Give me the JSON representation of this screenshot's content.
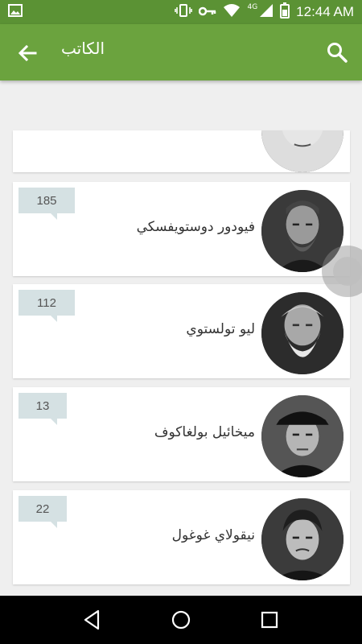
{
  "status_bar": {
    "time": "12:44 AM",
    "network": "4G",
    "icons": [
      "image-icon",
      "vibrate-icon",
      "key-icon",
      "wifi-icon",
      "signal-icon",
      "battery-icon"
    ]
  },
  "app_bar": {
    "title": "الكاتب",
    "back_icon": "arrow-back-icon",
    "search_icon": "search-icon",
    "color": "#6ba33e"
  },
  "authors": [
    {
      "name": "",
      "count": ""
    },
    {
      "name": "فيودور دوستويفسكي",
      "count": "185"
    },
    {
      "name": "ليو تولستوي",
      "count": "112"
    },
    {
      "name": "ميخائيل بولغاكوف",
      "count": "13"
    },
    {
      "name": "نيقولاي غوغول",
      "count": "22"
    }
  ],
  "nav_bar": {
    "back_icon": "nav-back-icon",
    "home_icon": "nav-home-icon",
    "recents_icon": "nav-recents-icon"
  },
  "badge_color": "#d5e1e3"
}
